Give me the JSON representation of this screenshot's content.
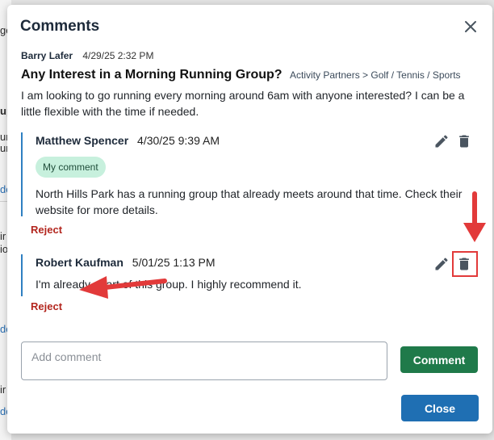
{
  "background": {
    "fragments": [
      "go",
      "ur",
      "ur",
      "up",
      "do",
      "do",
      "ir",
      "io",
      "ir v",
      "do"
    ]
  },
  "modal": {
    "title": "Comments",
    "post": {
      "author": "Barry Lafer",
      "timestamp": "4/29/25 2:32 PM",
      "title": "Any Interest in a Morning Running Group?",
      "category": "Activity Partners > Golf / Tennis / Sports",
      "body": "I am looking to go running every morning around 6am with anyone interested? I can be a little flexible with the time if needed."
    },
    "comments": [
      {
        "author": "Matthew Spencer",
        "timestamp": "4/30/25 9:39 AM",
        "badge": "My comment",
        "text": "North Hills Park has a running group that already meets around that time. Check their website for more details.",
        "reject_label": "Reject"
      },
      {
        "author": "Robert Kaufman",
        "timestamp": "5/01/25 1:13 PM",
        "text": "I'm already apart of this group. I highly recommend it.",
        "reject_label": "Reject"
      }
    ],
    "input": {
      "placeholder": "Add comment",
      "value": ""
    },
    "comment_button": "Comment",
    "close_button": "Close"
  },
  "icons": {
    "close": "close-icon",
    "edit": "pencil-icon",
    "delete": "trash-icon",
    "annotation_arrow": "red-arrow-annotation"
  },
  "colors": {
    "comment_button": "#1f7a4a",
    "close_button": "#1f6fb3",
    "reject_text": "#b3261e",
    "badge_bg": "#c7f0dd",
    "thread_border": "#2f80c2",
    "annotation_red": "#e23a3a"
  }
}
